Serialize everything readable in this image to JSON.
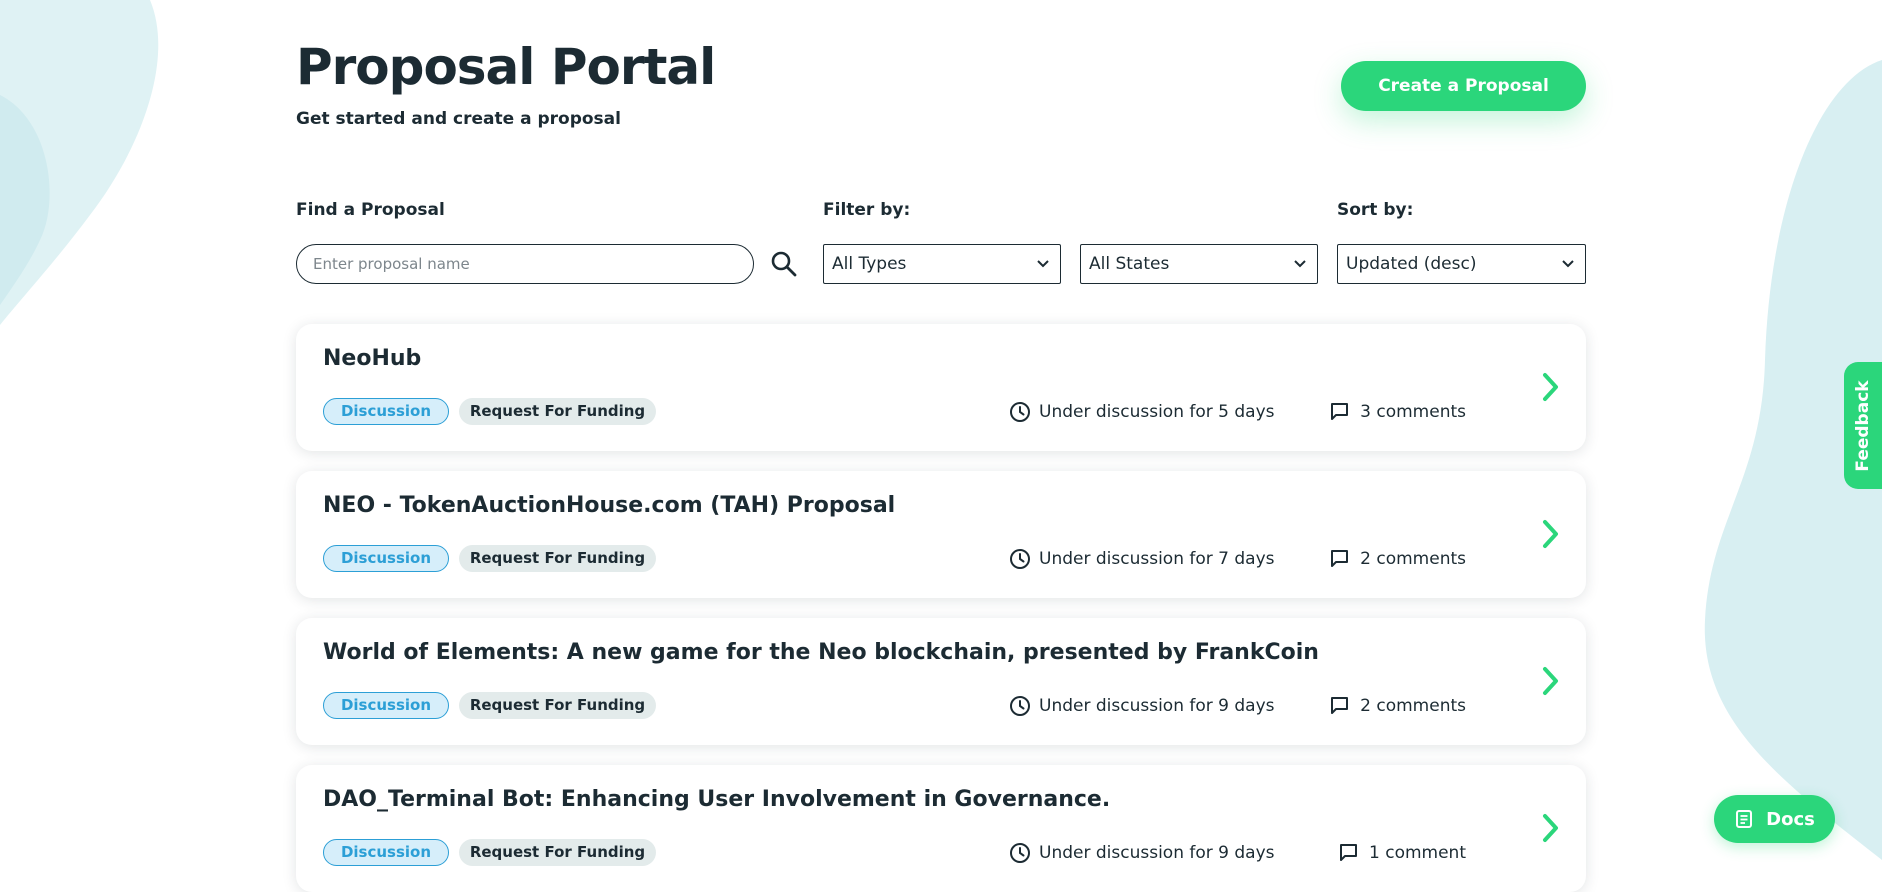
{
  "header": {
    "title": "Proposal Portal",
    "subtitle": "Get started and create a proposal",
    "create_button": "Create a Proposal"
  },
  "search": {
    "label": "Find a Proposal",
    "placeholder": "Enter proposal name",
    "value": ""
  },
  "filters": {
    "label": "Filter by:",
    "type_selected": "All Types",
    "state_selected": "All States"
  },
  "sort": {
    "label": "Sort by:",
    "selected": "Updated (desc)"
  },
  "proposals": [
    {
      "title": "NeoHub",
      "state": "Discussion",
      "type": "Request For Funding",
      "status": "Under discussion for 5 days",
      "comments": "3 comments"
    },
    {
      "title": "NEO - TokenAuctionHouse.com (TAH) Proposal",
      "state": "Discussion",
      "type": "Request For Funding",
      "status": "Under discussion for 7 days",
      "comments": "2 comments"
    },
    {
      "title": "World of Elements: A new game for the Neo blockchain, presented by FrankCoin",
      "state": "Discussion",
      "type": "Request For Funding",
      "status": "Under discussion for 9 days",
      "comments": "2 comments"
    },
    {
      "title": "DAO_Terminal Bot: Enhancing User Involvement in Governance.",
      "state": "Discussion",
      "type": "Request For Funding",
      "status": "Under discussion for 9 days",
      "comments": "1 comment"
    }
  ],
  "feedback_label": "Feedback",
  "docs_label": "Docs",
  "colors": {
    "accent": "#2bd67b",
    "text": "#1c2b33",
    "discussion_tag": "#2c9fd6",
    "background_blob": "#d8eff2"
  }
}
